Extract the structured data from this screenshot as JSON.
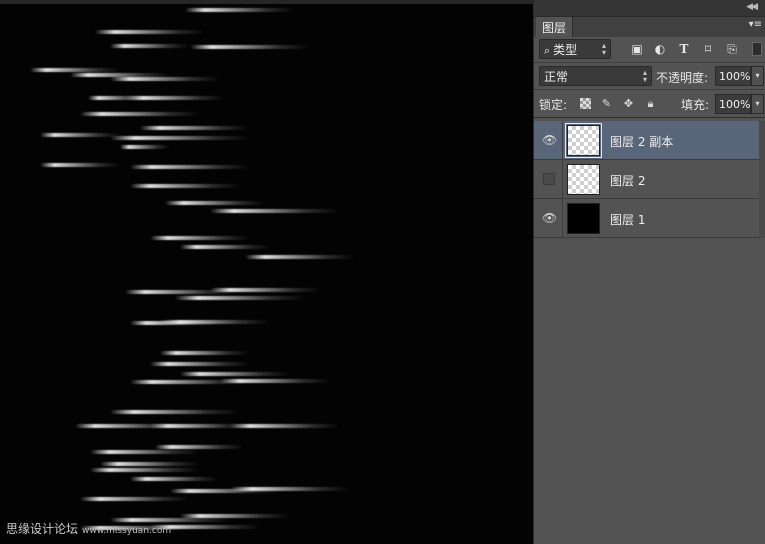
{
  "canvas": {
    "background": "#030303",
    "watermark": {
      "text": "思缘设计论坛",
      "url": "www.missyuan.com"
    }
  },
  "panel": {
    "collapse_icon": "double-chevron-left-icon",
    "tab_label": "图层",
    "tab_menu_icon": "panel-menu-icon",
    "filter": {
      "kind_value": "类型",
      "icons": [
        "image-filter-icon",
        "adjustment-filter-icon",
        "type-filter-icon",
        "shape-filter-icon",
        "smartobject-filter-icon"
      ]
    },
    "blend": {
      "mode_value": "正常",
      "opacity_label": "不透明度:",
      "opacity_value": "100%"
    },
    "lock": {
      "label": "锁定:",
      "fill_label": "填充:",
      "fill_value": "100%"
    },
    "layers": [
      {
        "name": "图层 2 副本",
        "visible": true,
        "selected": true,
        "thumb": "transparent"
      },
      {
        "name": "图层 2",
        "visible": false,
        "selected": false,
        "thumb": "transparent"
      },
      {
        "name": "图层 1",
        "visible": true,
        "selected": false,
        "thumb": "black"
      }
    ],
    "accent": "#596579"
  }
}
